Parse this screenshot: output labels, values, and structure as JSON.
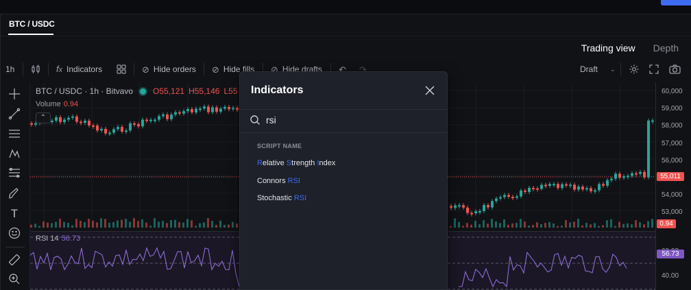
{
  "header": {
    "pair_tab": "BTC / USDC",
    "views": [
      "Trading view",
      "Depth"
    ],
    "active_view": "Trading view"
  },
  "toolbar": {
    "interval": "1h",
    "indicators_label": "Indicators",
    "hide_orders_label": "Hide orders",
    "hide_fills_label": "Hide fills",
    "hide_drafts_label": "Hide drafts",
    "draft_label": "Draft"
  },
  "chart": {
    "symbol_line": "BTC / USDC · 1h · Bitvavo",
    "open": "O55,121",
    "high": "H55,146",
    "low": "L55",
    "volume_label": "Volume",
    "volume_value": "0.94",
    "rsi_label": "RSI 14",
    "rsi_value": "56.73",
    "price_axis": [
      "60,000",
      "59,000",
      "58,000",
      "57,000",
      "56,000",
      "55,011",
      "54,000",
      "53,000"
    ],
    "rsi_axis": [
      "60.00",
      "56.73",
      "40.00"
    ],
    "current_price_tag": "55,011",
    "volume_tag": "0.94",
    "rsi_tag": "56.73",
    "colors": {
      "up": "#26a69a",
      "down": "#ef5350",
      "rsi": "#8e6cd6",
      "accent": "#3d6cf3"
    }
  },
  "modal": {
    "title": "Indicators",
    "search_value": "rsi",
    "section_label": "SCRIPT NAME",
    "results": [
      {
        "segments": [
          [
            "R",
            true
          ],
          [
            "elative ",
            false
          ],
          [
            "S",
            true
          ],
          [
            "trength ",
            false
          ],
          [
            "I",
            true
          ],
          [
            "ndex",
            false
          ]
        ]
      },
      {
        "segments": [
          [
            "Connors ",
            false
          ],
          [
            "RSI",
            true
          ]
        ]
      },
      {
        "segments": [
          [
            "Stochastic ",
            false
          ],
          [
            "RSI",
            true
          ]
        ]
      }
    ]
  }
}
